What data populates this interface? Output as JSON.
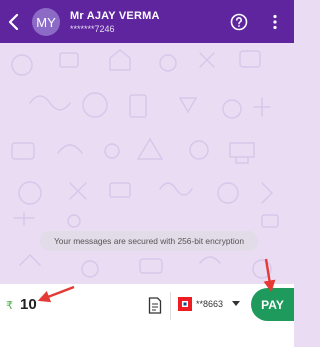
{
  "header": {
    "avatar_initials": "MY",
    "name": "Mr AJAY VERMA",
    "phone": "*******7246",
    "bg_color": "#5f259f"
  },
  "chat": {
    "encryption_notice": "Your messages are secured with 256-bit encryption",
    "bg_color": "#e9dcf3"
  },
  "payment": {
    "currency_symbol": "₹",
    "amount": "10",
    "account_masked": "**8663",
    "pay_label": "PAY",
    "pay_color": "#1e9a5c"
  },
  "icons": {
    "back": "back-arrow-icon",
    "help": "help-icon",
    "more": "more-vert-icon",
    "note": "note-icon",
    "bank": "bank-logo-icon",
    "caret": "dropdown-caret-icon"
  },
  "annotations": {
    "arrow_color": "#e53935"
  }
}
